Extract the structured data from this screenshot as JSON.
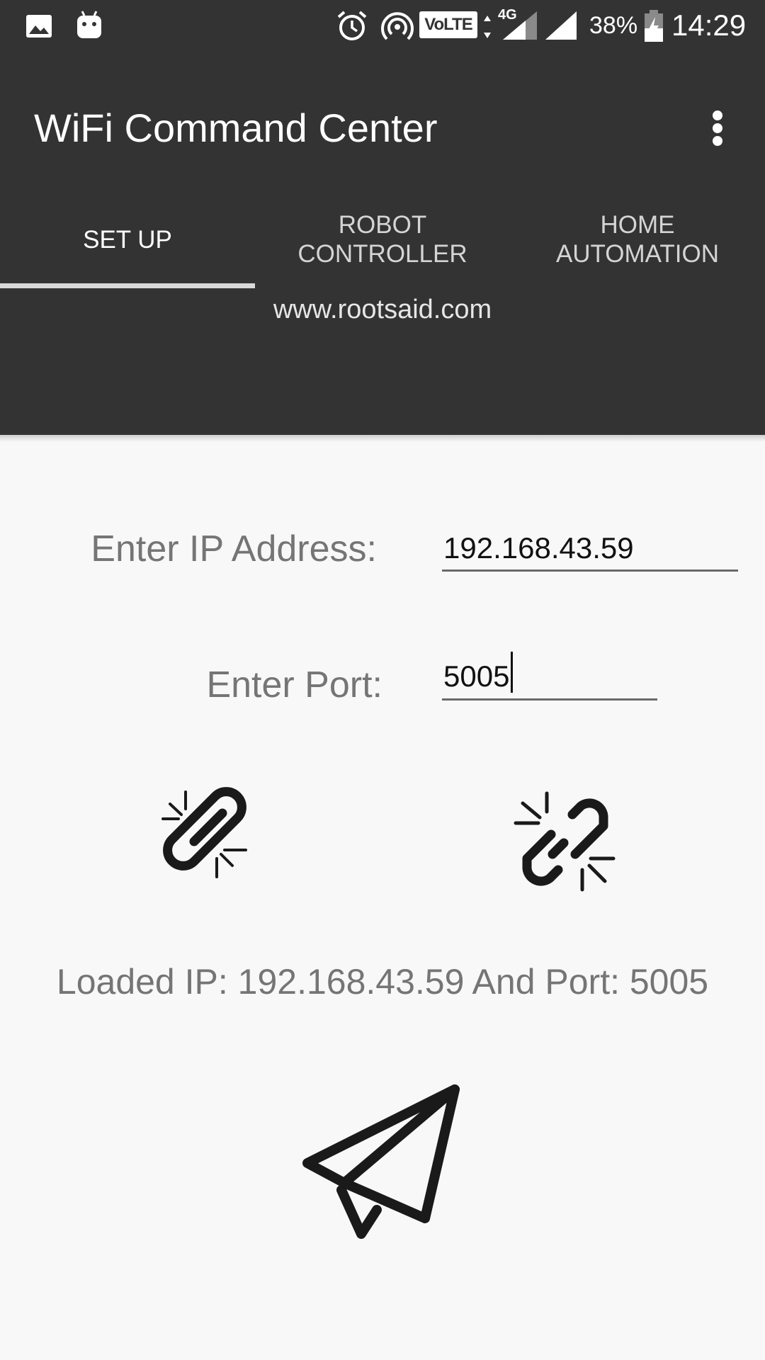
{
  "status_bar": {
    "volte": "VoLTE",
    "network": "4G",
    "battery_percent": "38%",
    "time": "14:29",
    "icons": [
      "image-icon",
      "android-icon",
      "alarm-icon",
      "hotspot-icon",
      "volte-icon",
      "data-arrows-icon",
      "signal-icon",
      "signal-icon",
      "battery-icon"
    ]
  },
  "app_bar": {
    "title": "WiFi Command Center",
    "menu_icon": "more-vert-icon"
  },
  "tabs": [
    {
      "label": "SET UP",
      "active": true
    },
    {
      "label": "ROBOT\nCONTROLLER",
      "active": false
    },
    {
      "label": "HOME\nAUTOMATION",
      "active": false
    }
  ],
  "website": "www.rootsaid.com",
  "form": {
    "ip_label": "Enter IP Address:",
    "ip_value": "192.168.43.59",
    "port_label": "Enter Port:",
    "port_value": "5005"
  },
  "actions": {
    "connect_icon": "link-icon",
    "disconnect_icon": "unlink-icon",
    "send_icon": "paper-plane-icon"
  },
  "loaded_text": "Loaded IP: 192.168.43.59 And Port: 5005",
  "colors": {
    "toolbar": "#333333",
    "background": "#f8f8f8",
    "label_text": "#757575",
    "tab_indicator": "#d9d9d9"
  }
}
